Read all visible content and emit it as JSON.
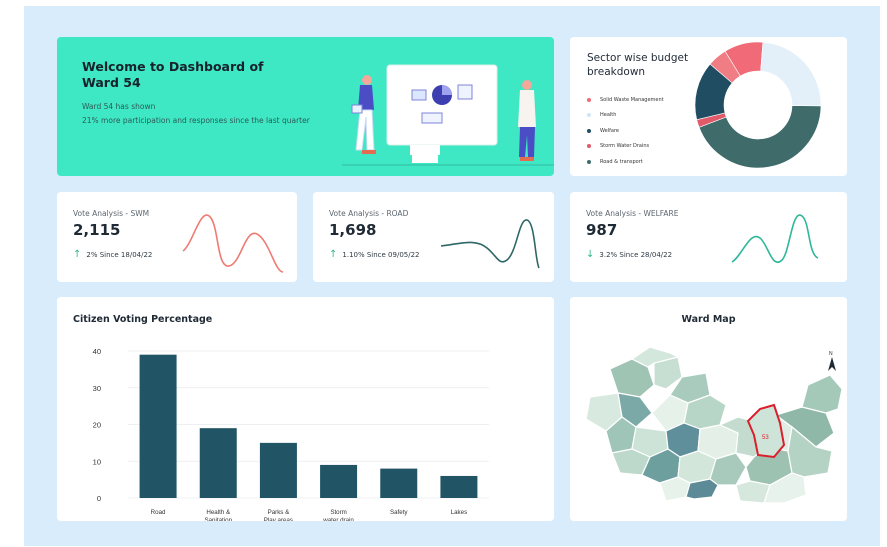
{
  "welcome": {
    "title": "Welcome to Dashboard of Ward 54",
    "line1": "Ward 54 has shown",
    "line2": "21% more participation and responses since the last quarter"
  },
  "sector": {
    "title": "Sector wise budget breakdown",
    "legend": [
      {
        "label": "Solid Waste Management",
        "color": "#f06b77"
      },
      {
        "label": "Health",
        "color": "#e3f0fa"
      },
      {
        "label": "Welfare",
        "color": "#214d63"
      },
      {
        "label": "Storm Water Drains",
        "color": "#e05a6a"
      },
      {
        "label": "Road & transport",
        "color": "#3f6b6b"
      }
    ]
  },
  "votes": [
    {
      "label": "Vote Analysis - SWM",
      "value": "2,115",
      "change": "2% Since 18/04/22",
      "direction": "up",
      "color": "#ee7e76"
    },
    {
      "label": "Vote Analysis - ROAD",
      "value": "1,698",
      "change": "1.10% Since 09/05/22",
      "direction": "up",
      "color": "#2e6766"
    },
    {
      "label": "Vote Analysis - WELFARE",
      "value": "987",
      "change": "3.2% Since 28/04/22",
      "direction": "down",
      "color": "#2fb79a"
    }
  ],
  "voting_title": "Citizen Voting Percentage",
  "chart_data": {
    "type": "bar",
    "title": "Citizen Voting Percentage",
    "categories": [
      "Road",
      "Health & Sanitation",
      "Parks & Play areas",
      "Storm water drain",
      "Safety",
      "Lakes"
    ],
    "category_lines": [
      [
        "Road"
      ],
      [
        "Health  &",
        "Sanitation"
      ],
      [
        "Parks &",
        "Play areas"
      ],
      [
        "Storm",
        "water drain"
      ],
      [
        "Safety"
      ],
      [
        "Lakes"
      ]
    ],
    "values": [
      39,
      19,
      15,
      9,
      8,
      6
    ],
    "yticks": [
      0,
      10,
      20,
      30,
      40
    ],
    "ylim": [
      0,
      40
    ],
    "xlabel": "",
    "ylabel": "",
    "grid": true,
    "bar_color": "#215566"
  },
  "map": {
    "title": "Ward Map",
    "ward_label": "53",
    "north_label": "N"
  },
  "donut_data": {
    "type": "pie",
    "segments": [
      {
        "label": "Solid Waste Management",
        "value": 10,
        "color": "#f06b77"
      },
      {
        "label": "Health",
        "value": 24,
        "color": "#e3f0fa"
      },
      {
        "label": "Road & transport",
        "value": 44,
        "color": "#3f6b6b"
      },
      {
        "label": "Storm Water Drains",
        "value": 2,
        "color": "#e05a6a"
      },
      {
        "label": "Welfare",
        "value": 15,
        "color": "#214d63"
      },
      {
        "label": "Storm Water Drains",
        "value": 5,
        "color": "#f07c84"
      }
    ]
  }
}
